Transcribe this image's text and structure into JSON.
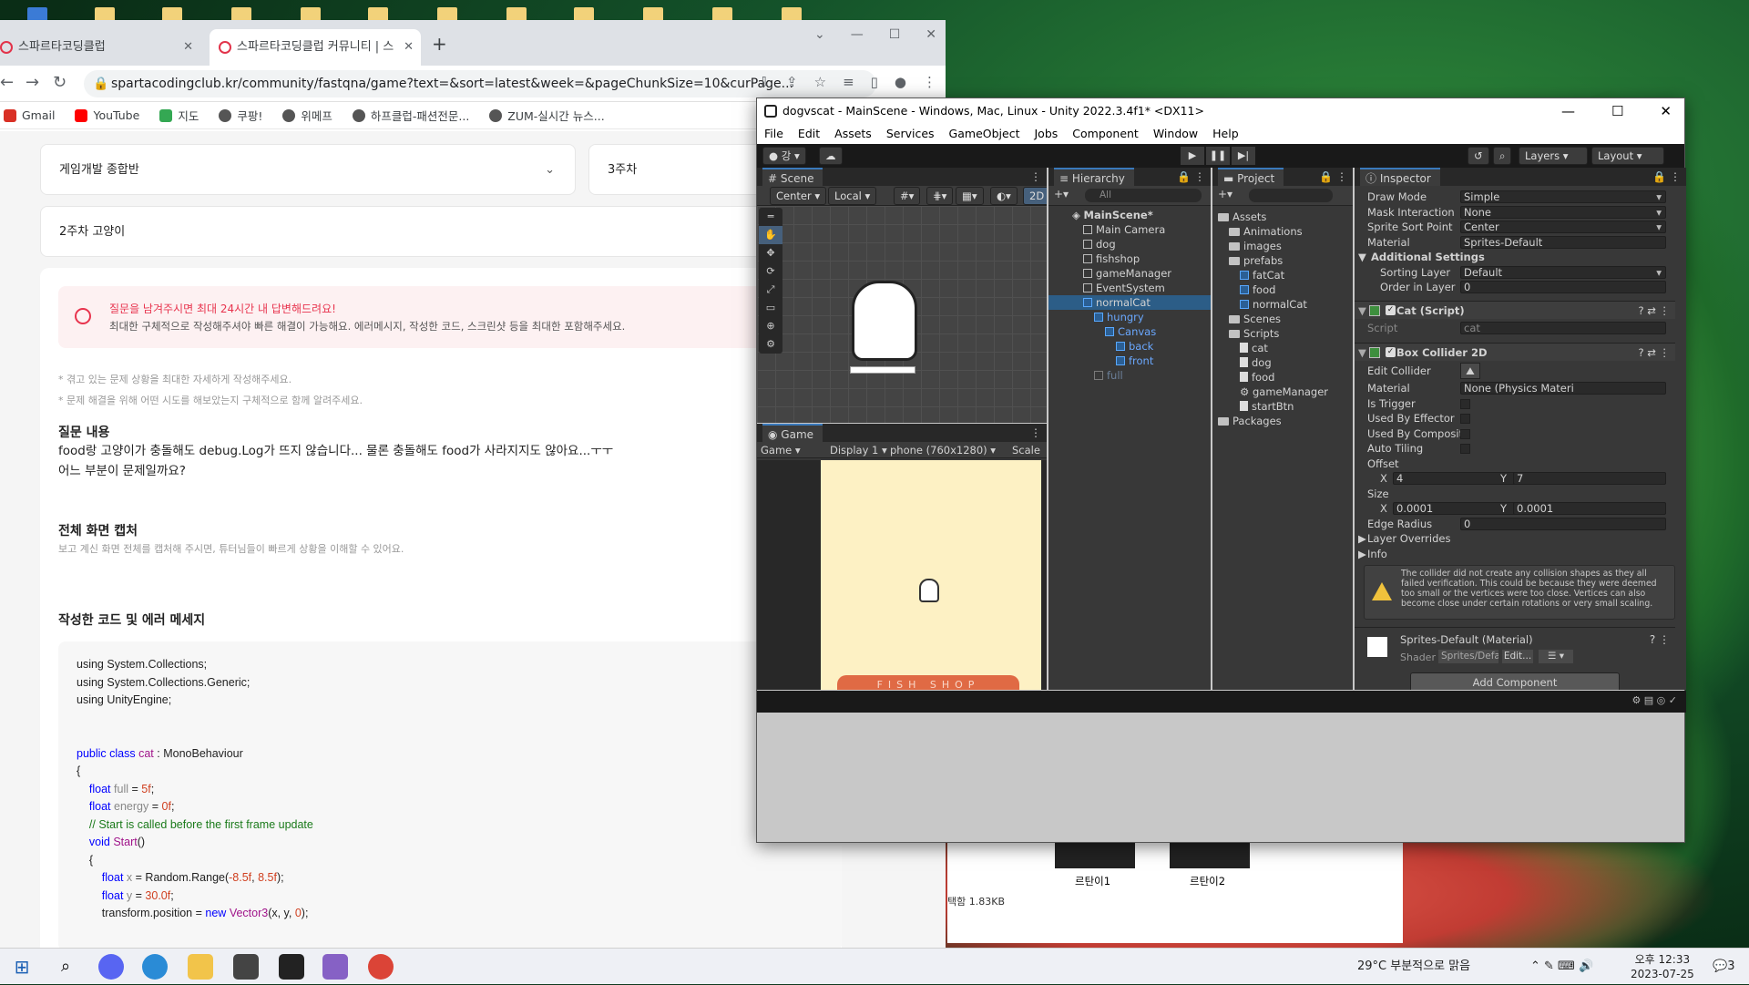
{
  "chrome": {
    "tabs": [
      {
        "label": "스파르타코딩클럽"
      },
      {
        "label": "스파르타코딩클럽 커뮤니티 | 스"
      }
    ],
    "url": "spartacodingclub.kr/community/fastqna/game?text=&sort=latest&week=&pageChunkSize=10&curPage...",
    "bookmarks": [
      "Gmail",
      "YouTube",
      "지도",
      "쿠팡!",
      "위메프",
      "하프클럽-패션전문...",
      "ZUM-실시간 뉴스..."
    ]
  },
  "page": {
    "course_select": "게임개발 종합반",
    "week_select": "3주차",
    "title_input": "2주차 고양이",
    "notice_title": "질문을 남겨주시면 최대 24시간 내 답변해드려요!",
    "notice_body": "최대한 구체적으로 작성해주셔야 빠른 해결이 가능해요. 에러메시지, 작성한 코드, 스크린샷 등을 최대한 포함해주세요.",
    "hint1": "* 겪고 있는 문제 상황을 최대한 자세하게 작성해주세요.",
    "hint2": "* 문제 해결을 위해 어떤 시도를 해보았는지 구체적으로 함께 알려주세요.",
    "q_heading": "질문 내용",
    "q_line1": "food랑 고양이가 충돌해도 debug.Log가 뜨지 않습니다... 물론 충돌해도 food가 사라지지도 않아요...ㅜㅜ",
    "q_line2": "어느 부분이 문제일까요?",
    "capture_heading": "전체 화면 캡처",
    "capture_hint": "보고 계신 화면 전체를 캡처해 주시면, 튜터님들이 빠르게 상황을 이해할 수 있어요.",
    "code_heading": "작성한 코드 및 에러 메세지",
    "code_lines": [
      "using System.Collections;",
      "using System.Collections.Generic;",
      "using UnityEngine;"
    ],
    "attach": {
      "file1": "르탄이1",
      "file2": "르탄이2",
      "size": "택함 1.83KB"
    }
  },
  "unity": {
    "title": "dogvscat - MainScene - Windows, Mac, Linux - Unity 2022.3.4f1* <DX11>",
    "menu": [
      "File",
      "Edit",
      "Assets",
      "Services",
      "GameObject",
      "Jobs",
      "Component",
      "Window",
      "Help"
    ],
    "account": "강",
    "layers": "Layers",
    "layout": "Layout",
    "scene_tab": "Scene",
    "scene_pivot": "Center",
    "scene_space": "Local",
    "scene_2d": "2D",
    "game_tab": "Game",
    "game_mode": "Game",
    "display": "Display 1",
    "resolution": "phone (760x1280)",
    "scale": "Scale",
    "game_sign": "FISH SHOP",
    "hierarchy_tab": "Hierarchy",
    "hierarchy_search": "All",
    "hierarchy": [
      {
        "name": "MainScene*",
        "depth": 0,
        "kind": "scene"
      },
      {
        "name": "Main Camera",
        "depth": 1,
        "kind": "obj"
      },
      {
        "name": "dog",
        "depth": 1,
        "kind": "obj"
      },
      {
        "name": "fishshop",
        "depth": 1,
        "kind": "obj"
      },
      {
        "name": "gameManager",
        "depth": 1,
        "kind": "obj"
      },
      {
        "name": "EventSystem",
        "depth": 1,
        "kind": "obj"
      },
      {
        "name": "normalCat",
        "depth": 1,
        "kind": "prefab"
      },
      {
        "name": "hungry",
        "depth": 2,
        "kind": "child"
      },
      {
        "name": "Canvas",
        "depth": 3,
        "kind": "child"
      },
      {
        "name": "back",
        "depth": 4,
        "kind": "child"
      },
      {
        "name": "front",
        "depth": 4,
        "kind": "child"
      },
      {
        "name": "full",
        "depth": 2,
        "kind": "disabled"
      }
    ],
    "project_tab": "Project",
    "project": [
      {
        "name": "Assets",
        "depth": 0,
        "kind": "folder"
      },
      {
        "name": "Animations",
        "depth": 1,
        "kind": "folder"
      },
      {
        "name": "images",
        "depth": 1,
        "kind": "folder"
      },
      {
        "name": "prefabs",
        "depth": 1,
        "kind": "folder"
      },
      {
        "name": "fatCat",
        "depth": 2,
        "kind": "prefab"
      },
      {
        "name": "food",
        "depth": 2,
        "kind": "prefab"
      },
      {
        "name": "normalCat",
        "depth": 2,
        "kind": "prefab"
      },
      {
        "name": "Scenes",
        "depth": 1,
        "kind": "folder"
      },
      {
        "name": "Scripts",
        "depth": 1,
        "kind": "folder"
      },
      {
        "name": "cat",
        "depth": 2,
        "kind": "script"
      },
      {
        "name": "dog",
        "depth": 2,
        "kind": "script"
      },
      {
        "name": "food",
        "depth": 2,
        "kind": "script"
      },
      {
        "name": "gameManager",
        "depth": 2,
        "kind": "gear"
      },
      {
        "name": "startBtn",
        "depth": 2,
        "kind": "script"
      },
      {
        "name": "Packages",
        "depth": 0,
        "kind": "folder"
      }
    ],
    "inspector_tab": "Inspector",
    "sprite": {
      "draw_mode_label": "Draw Mode",
      "draw_mode": "Simple",
      "mask_label": "Mask Interaction",
      "mask": "None",
      "sort_point_label": "Sprite Sort Point",
      "sort_point": "Center",
      "material_label": "Material",
      "material": "Sprites-Default",
      "additional": "Additional Settings",
      "sorting_layer_label": "Sorting Layer",
      "sorting_layer": "Default",
      "order_label": "Order in Layer",
      "order": "0"
    },
    "cat_script": {
      "title": "Cat (Script)",
      "script_label": "Script",
      "script": "cat"
    },
    "box": {
      "title": "Box Collider 2D",
      "edit_label": "Edit Collider",
      "material_label": "Material",
      "material": "None (Physics Materi",
      "trigger_label": "Is Trigger",
      "effector_label": "Used By Effector",
      "composite_label": "Used By Composite",
      "tiling_label": "Auto Tiling",
      "offset_label": "Offset",
      "offset_x": "4",
      "offset_y": "7",
      "size_label": "Size",
      "size_x": "0.0001",
      "size_y": "0.0001",
      "radius_label": "Edge Radius",
      "radius": "0",
      "layer_overrides": "Layer Overrides",
      "info": "Info",
      "warning": "The collider did not create any collision shapes as they all failed verification.  This could be because they were deemed too small or the vertices were too close.  Vertices can also become close under certain rotations or very small scaling."
    },
    "material_block": {
      "title": "Sprites-Default (Material)",
      "shader_label": "Shader",
      "shader": "Sprites/Defa",
      "edit": "Edit..."
    },
    "add_component": "Add Component"
  },
  "taskbar": {
    "weather": "29°C  부분적으로 맑음",
    "time": "오후 12:33",
    "date": "2023-07-25",
    "notif": "3"
  }
}
